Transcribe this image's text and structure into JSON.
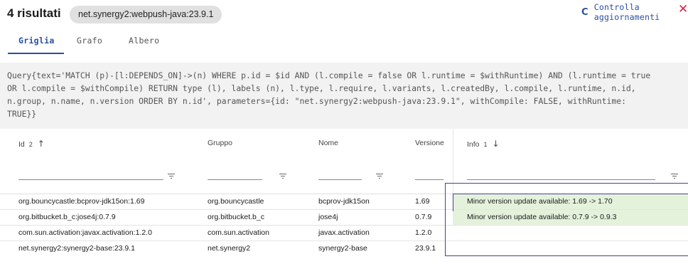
{
  "header": {
    "results_label": "4 risultati",
    "dependency_chip": "net.synergy2:webpush-java:23.9.1",
    "refresh_label": "Controlla aggiornamenti",
    "refresh_icon": "C",
    "close_icon": "✕"
  },
  "tabs": [
    {
      "label": "Griglia",
      "active": true
    },
    {
      "label": "Grafo",
      "active": false
    },
    {
      "label": "Albero",
      "active": false
    }
  ],
  "query": {
    "lines": [
      "Query{text='MATCH (p)-[l:DEPENDS_ON]->(n) WHERE p.id = $id AND (l.compile = false OR l.runtime = $withRuntime) AND (l.runtime = true",
      "OR l.compile = $withCompile) RETURN type (l), labels (n), l.type, l.require, l.variants, l.createdBy, l.compile, l.runtime, n.id,",
      "n.group, n.name, n.version ORDER BY n.id', parameters={id: \"net.synergy2:webpush-java:23.9.1\", withCompile: FALSE, withRuntime:",
      "TRUE}}"
    ]
  },
  "grid": {
    "columns": [
      {
        "label": "Id",
        "sort_index": "2",
        "sort_arrow": "↑"
      },
      {
        "label": "Gruppo"
      },
      {
        "label": "Nome"
      },
      {
        "label": "Versione"
      },
      {
        "label": "Info",
        "sort_index": "1",
        "sort_arrow": "↓"
      }
    ],
    "rows": [
      {
        "id": "org.bouncycastle:bcprov-jdk15on:1.69",
        "group": "org.bouncycastle",
        "name": "bcprov-jdk15on",
        "version": "1.69",
        "info": "Minor version update available: 1.69 -> 1.70"
      },
      {
        "id": "org.bitbucket.b_c:jose4j:0.7.9",
        "group": "org.bitbucket.b_c",
        "name": "jose4j",
        "version": "0.7.9",
        "info": "Minor version update available: 0.7.9 -> 0.9.3"
      },
      {
        "id": "com.sun.activation:javax.activation:1.2.0",
        "group": "com.sun.activation",
        "name": "javax.activation",
        "version": "1.2.0",
        "info": ""
      },
      {
        "id": "net.synergy2:synergy2-base:23.9.1",
        "group": "net.synergy2",
        "name": "synergy2-base",
        "version": "23.9.1",
        "info": ""
      }
    ]
  },
  "colors": {
    "accent": "#2a4fa0",
    "close": "#d8234a",
    "info_highlight": "#e4f2dc",
    "selection": "#4b3e9e"
  }
}
